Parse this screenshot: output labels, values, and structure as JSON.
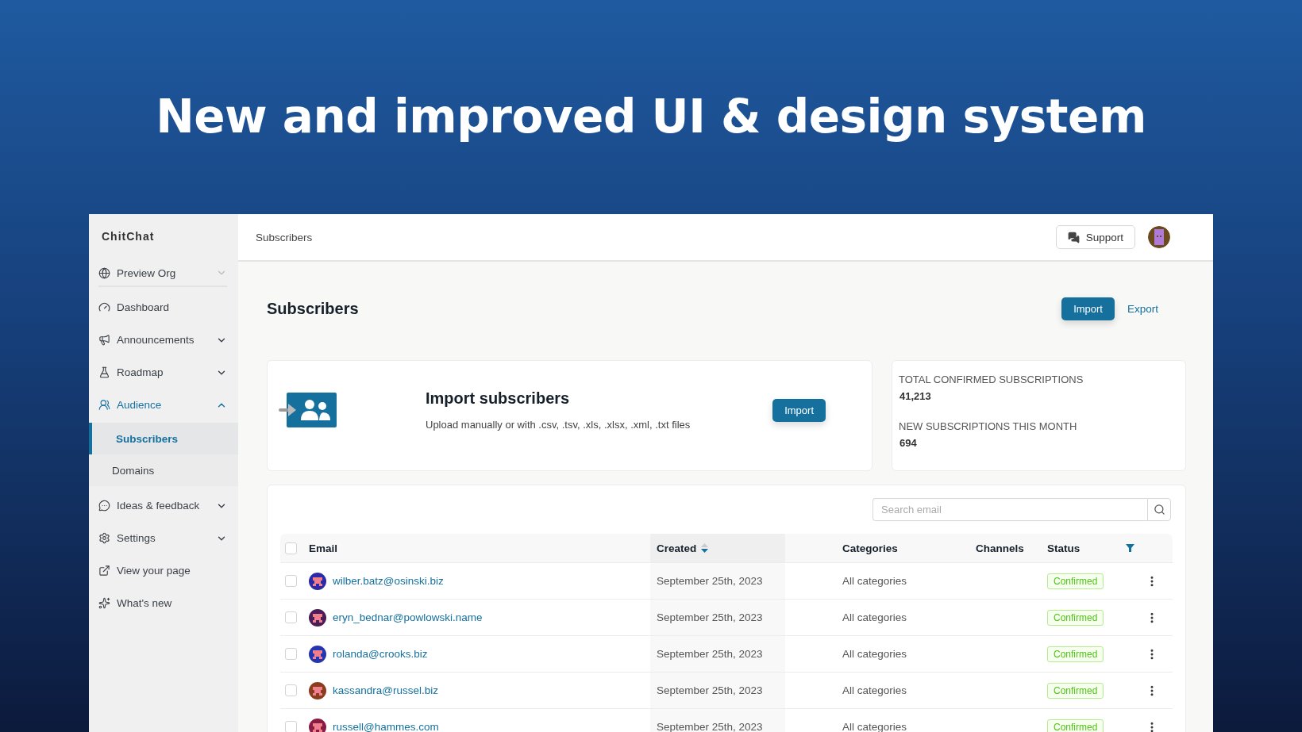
{
  "banner": {
    "title": "New and improved UI & design system"
  },
  "sidebar": {
    "brand": "ChitChat",
    "items": [
      {
        "label": "Preview Org",
        "kind": "dropdown",
        "selected": false
      },
      {
        "label": "Dashboard",
        "kind": "link",
        "selected": false
      },
      {
        "label": "Announcements",
        "kind": "group",
        "expanded": false,
        "selected": false
      },
      {
        "label": "Roadmap",
        "kind": "group",
        "expanded": false,
        "selected": false
      },
      {
        "label": "Audience",
        "kind": "group",
        "expanded": true,
        "selected": true,
        "children": [
          {
            "label": "Subscribers",
            "selected": true
          },
          {
            "label": "Domains",
            "selected": false
          }
        ]
      },
      {
        "label": "Ideas & feedback",
        "kind": "group",
        "expanded": false,
        "selected": false
      },
      {
        "label": "Settings",
        "kind": "group",
        "expanded": false,
        "selected": false
      },
      {
        "label": "View your page",
        "kind": "link",
        "selected": false
      },
      {
        "label": "What's new",
        "kind": "link",
        "selected": false
      }
    ]
  },
  "header": {
    "breadcrumb": "Subscribers",
    "support_button": "Support"
  },
  "page": {
    "title": "Subscribers",
    "import_button": "Import",
    "export_link": "Export"
  },
  "import_card": {
    "title": "Import subscribers",
    "description": "Upload manually or with .csv, .tsv, .xls, .xlsx, .xml, .txt files",
    "button": "Import"
  },
  "stats": [
    {
      "label": "TOTAL CONFIRMED SUBSCRIPTIONS",
      "value": "41,213"
    },
    {
      "label": "NEW SUBSCRIPTIONS THIS MONTH",
      "value": "694"
    }
  ],
  "table": {
    "search": {
      "placeholder": "Search email"
    },
    "all_checked": false,
    "columns": [
      {
        "label": "Email",
        "kind": "text"
      },
      {
        "label": "Created",
        "kind": "sorted"
      },
      {
        "label": "Categories",
        "kind": "text"
      },
      {
        "label": "Channels",
        "kind": "text"
      },
      {
        "label": "Status",
        "kind": "filter"
      }
    ],
    "rows": [
      {
        "checked": false,
        "email": "wilber.batz@osinski.biz",
        "color": "#2b2ba6",
        "created": "September 25th, 2023",
        "categories": "All categories",
        "status": "Confirmed"
      },
      {
        "checked": false,
        "email": "eryn_bednar@powlowski.name",
        "color": "#4b1c55",
        "created": "September 25th, 2023",
        "categories": "All categories",
        "status": "Confirmed"
      },
      {
        "checked": false,
        "email": "rolanda@crooks.biz",
        "color": "#2435b0",
        "created": "September 25th, 2023",
        "categories": "All categories",
        "status": "Confirmed"
      },
      {
        "checked": false,
        "email": "kassandra@russel.biz",
        "color": "#8a3c1c",
        "created": "September 25th, 2023",
        "categories": "All categories",
        "status": "Confirmed"
      },
      {
        "checked": false,
        "email": "russell@hammes.com",
        "color": "#8a1c44",
        "created": "September 25th, 2023",
        "categories": "All categories",
        "status": "Confirmed"
      }
    ]
  }
}
